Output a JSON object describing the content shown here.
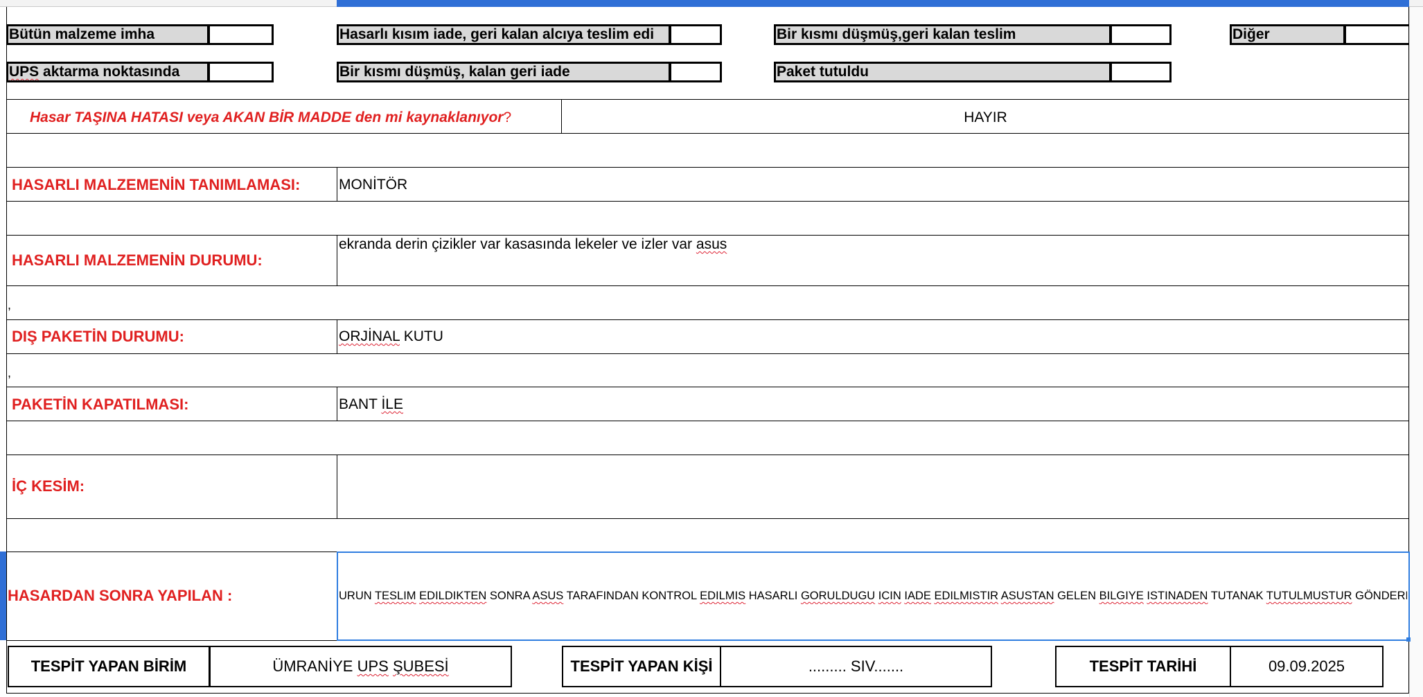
{
  "options": {
    "row1": [
      {
        "label": "Bütün malzeme imha"
      },
      {
        "label": "Hasarlı kısım iade, geri kalan alcıya teslim edi"
      },
      {
        "label": "Bir kısmı düşmüş,geri kalan teslim"
      },
      {
        "label": "Diğer"
      }
    ],
    "row2": [
      {
        "label": "UPS aktarma noktasında"
      },
      {
        "label": "Bir kısmı düşmüş, kalan geri iade"
      },
      {
        "label": "Paket tutuldu"
      }
    ]
  },
  "question": {
    "text": "Hasar TAŞINA HATASI veya AKAN BİR MADDE den mi kaynaklanıyor",
    "mark": "?",
    "answer": "HAYIR"
  },
  "rows": {
    "tanimlama": {
      "label": "HASARLI MALZEMENİN TANIMLAMASI:",
      "value": "MONİTÖR"
    },
    "durum": {
      "label": "HASARLI MALZEMENİN DURUMU:",
      "value": "ekranda derin çizikler var kasasında lekeler ve izler var asus"
    },
    "dis_paket": {
      "label": "DIŞ PAKETİN DURUMU:",
      "value": "ORJİNAL KUTU"
    },
    "kapatilma": {
      "label": "PAKETİN KAPATILMASI:",
      "value": "BANT İLE"
    },
    "ic_kesim": {
      "label": "İÇ KESİM:",
      "value": ""
    },
    "sonra": {
      "label": "HASARDAN SONRA YAPILAN :",
      "value": "URUN TESLIM EDILDIKTEN SONRA ASUS TARAFINDAN KONTROL EDILMIS HASARLI GORULDUGU ICIN IADE EDILMISTIR ASUSTAN GELEN BILGIYE ISTINADEN TUTANAK TUTULMUSTUR GÖNDERENE İ"
    }
  },
  "stray_commas": [
    ",",
    ","
  ],
  "footer": {
    "birim_label": "TESPİT YAPAN BİRİM",
    "birim_value": "ÜMRANİYE UPS ŞUBESİ",
    "kisi_label": "TESPİT YAPAN KİŞİ",
    "kisi_value": "......... SIV.......",
    "tarih_label": "TESPİT TARİHİ",
    "tarih_value": "09.09.2025"
  },
  "colors": {
    "accent_red": "#e02020",
    "selection_blue": "#2f7de0",
    "option_fill": "#d9d9d9"
  }
}
